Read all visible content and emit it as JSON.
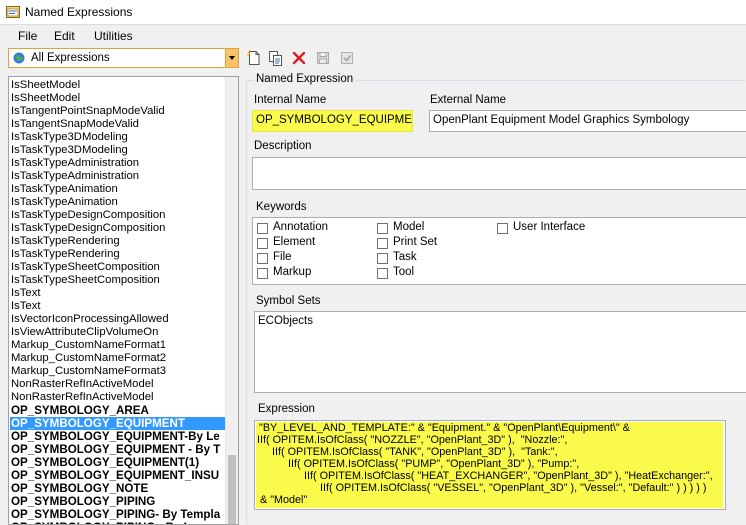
{
  "window": {
    "title": "Named Expressions"
  },
  "menu": [
    "File",
    "Edit",
    "Utilities"
  ],
  "toolbar": {
    "filter_value": "All Expressions",
    "buttons": [
      "new-icon",
      "copy-icon",
      "delete-icon",
      "save-icon",
      "apply-icon"
    ]
  },
  "list": {
    "items": [
      {
        "text": "IsSheetModel",
        "bold": false
      },
      {
        "text": "IsSheetModel",
        "bold": false
      },
      {
        "text": "IsTangentPointSnapModeValid",
        "bold": false
      },
      {
        "text": "IsTangentSnapModeValid",
        "bold": false
      },
      {
        "text": "IsTaskType3DModeling",
        "bold": false
      },
      {
        "text": "IsTaskType3DModeling",
        "bold": false
      },
      {
        "text": "IsTaskTypeAdministration",
        "bold": false
      },
      {
        "text": "IsTaskTypeAdministration",
        "bold": false
      },
      {
        "text": "IsTaskTypeAnimation",
        "bold": false
      },
      {
        "text": "IsTaskTypeAnimation",
        "bold": false
      },
      {
        "text": "IsTaskTypeDesignComposition",
        "bold": false
      },
      {
        "text": "IsTaskTypeDesignComposition",
        "bold": false
      },
      {
        "text": "IsTaskTypeRendering",
        "bold": false
      },
      {
        "text": "IsTaskTypeRendering",
        "bold": false
      },
      {
        "text": "IsTaskTypeSheetComposition",
        "bold": false
      },
      {
        "text": "IsTaskTypeSheetComposition",
        "bold": false
      },
      {
        "text": "IsText",
        "bold": false
      },
      {
        "text": "IsText",
        "bold": false
      },
      {
        "text": "IsVectorIconProcessingAllowed",
        "bold": false
      },
      {
        "text": "IsViewAttributeClipVolumeOn",
        "bold": false
      },
      {
        "text": "Markup_CustomNameFormat1",
        "bold": false
      },
      {
        "text": "Markup_CustomNameFormat2",
        "bold": false
      },
      {
        "text": "Markup_CustomNameFormat3",
        "bold": false
      },
      {
        "text": "NonRasterRefInActiveModel",
        "bold": false
      },
      {
        "text": "NonRasterRefInActiveModel",
        "bold": false
      },
      {
        "text": "OP_SYMBOLOGY_AREA",
        "bold": true
      },
      {
        "text": "OP_SYMBOLOGY_EQUIPMENT",
        "bold": true,
        "selected": true
      },
      {
        "text": "OP_SYMBOLOGY_EQUIPMENT-By Le",
        "bold": true
      },
      {
        "text": "OP_SYMBOLOGY_EQUIPMENT - By T",
        "bold": true
      },
      {
        "text": "OP_SYMBOLOGY_EQUIPMENT(1)",
        "bold": true
      },
      {
        "text": "OP_SYMBOLOGY_EQUIPMENT_INSU",
        "bold": true
      },
      {
        "text": "OP_SYMBOLOGY_NOTE",
        "bold": true
      },
      {
        "text": "OP_SYMBOLOGY_PIPING",
        "bold": true
      },
      {
        "text": "OP_SYMBOLOGY_PIPING- By Templa",
        "bold": true
      },
      {
        "text": "OP_SYMBOLOGY_PIPING - By Lev",
        "bold": true
      }
    ]
  },
  "detail": {
    "group_title": "Named Expression",
    "internal_name_label": "Internal Name",
    "internal_name_value": "OP_SYMBOLOGY_EQUIPMENT",
    "external_name_label": "External Name",
    "external_name_value": "OpenPlant Equipment Model Graphics Symbology",
    "description_label": "Description",
    "description_value": "",
    "keywords_label": "Keywords",
    "keywords": [
      {
        "label": "Annotation",
        "checked": false
      },
      {
        "label": "Element",
        "checked": false
      },
      {
        "label": "File",
        "checked": false
      },
      {
        "label": "Markup",
        "checked": false
      },
      {
        "label": "Model",
        "checked": false
      },
      {
        "label": "Print Set",
        "checked": false
      },
      {
        "label": "Task",
        "checked": false
      },
      {
        "label": "Tool",
        "checked": false
      },
      {
        "label": "User Interface",
        "checked": false
      }
    ],
    "symbol_sets_label": "Symbol Sets",
    "symbol_sets": [
      "ECObjects"
    ],
    "expression_label": "Expression",
    "expression_lines": [
      "\"BY_LEVEL_AND_TEMPLATE:\" & \"Equipment.\" & \"OpenPlant\\Equipment\\\" &",
      "IIf( OPITEM.IsOfClass( \"NOZZLE\", \"OpenPlant_3D\" ),  \"Nozzle:\",",
      "IIf( OPITEM.IsOfClass( \"TANK\", \"OpenPlant_3D\" ),  \"Tank:\",",
      "IIf( OPITEM.IsOfClass( \"PUMP\", \"OpenPlant_3D\" ), \"Pump:\",",
      "IIf( OPITEM.IsOfClass( \"HEAT_EXCHANGER\", \"OpenPlant_3D\" ), \"HeatExchanger:\",",
      "IIf( OPITEM.IsOfClass( \"VESSEL\", \"OpenPlant_3D\" ), \"Vessel:\", \"Default:\" ) ) ) ) )",
      "& \"Model\""
    ]
  },
  "colors": {
    "selection": "#3399ff",
    "highlight": "#fafa4b",
    "combo_accent": "#f5c46a"
  }
}
